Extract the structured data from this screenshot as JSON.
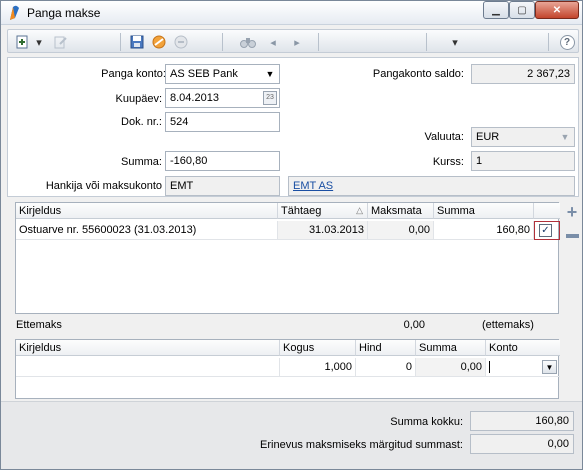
{
  "window": {
    "title": "Panga makse",
    "minimize": "▁",
    "maximize": "▢",
    "close": "✕"
  },
  "toolbar": {
    "new_icon": "new-doc-icon",
    "dropdown": "▾",
    "save": "💾",
    "prev": "◂",
    "next": "▸",
    "help": "?"
  },
  "header": {
    "bank_account_label": "Panga konto:",
    "bank_account_value": "AS SEB Pank",
    "date_label": "Kuupäev:",
    "date_value": "8.04.2013",
    "calendar_icon": "23",
    "doc_no_label": "Dok. nr.:",
    "doc_no_value": "524",
    "sum_label": "Summa:",
    "sum_value": "-160,80",
    "supplier_label": "Hankija või maksukonto",
    "supplier_code": "EMT",
    "supplier_link": "EMT AS",
    "bank_balance_label": "Pangakonto saldo:",
    "bank_balance_value": "2 367,23",
    "currency_label": "Valuuta:",
    "currency_value": "EUR",
    "rate_label": "Kurss:",
    "rate_value": "1"
  },
  "invoices": {
    "columns": [
      "Kirjeldus",
      "Tähtaeg",
      "Maksmata",
      "Summa"
    ],
    "sort_arrow": "△",
    "rows": [
      {
        "description": "Ostuarve nr. 55600023 (31.03.2013)",
        "due": "31.03.2013",
        "unpaid": "0,00",
        "sum": "160,80",
        "checked": "✓"
      }
    ]
  },
  "prepayment": {
    "label": "Ettemaks",
    "value": "0,00",
    "note": "(ettemaks)"
  },
  "lines": {
    "columns": [
      "Kirjeldus",
      "Kogus",
      "Hind",
      "Summa",
      "Konto"
    ],
    "rows": [
      {
        "description": "",
        "qty": "1,000",
        "price": "0",
        "sum": "0,00",
        "account": ""
      }
    ]
  },
  "footer": {
    "total_label": "Summa kokku:",
    "total_value": "160,80",
    "diff_label": "Erinevus maksmiseks märgitud summast:",
    "diff_value": "0,00"
  }
}
